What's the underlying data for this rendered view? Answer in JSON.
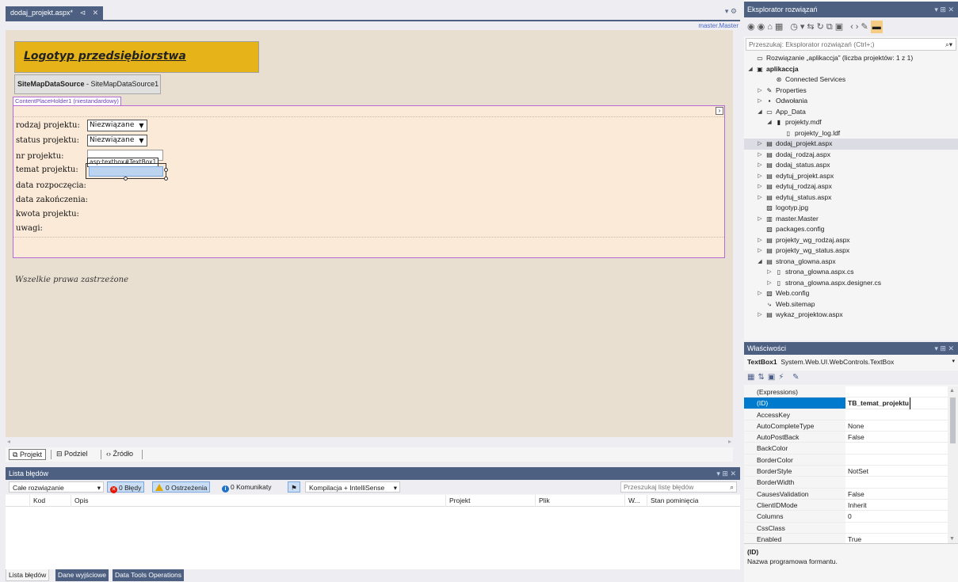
{
  "document": {
    "tab_label": "dodaj_projekt.aspx*",
    "tab_pin_icon": "⊲",
    "tab_close_icon": "✕",
    "master_link": "master.Master",
    "logo_text": "Logotyp przedsiębiorstwa",
    "sitemap_name": "SiteMapDataSource",
    "sitemap_id": " - SiteMapDataSource1",
    "content_placeholder_label": "ContentPlaceHolder1 (niestandardowy)",
    "form_fields": [
      {
        "label": "rodzaj projektu:",
        "control": "dropdown",
        "value": "Niezwiązane"
      },
      {
        "label": "status projektu:",
        "control": "dropdown",
        "value": "Niezwiązane"
      },
      {
        "label": "nr projektu:",
        "control": "textbox",
        "value": ""
      },
      {
        "label": "temat projektu:",
        "control": "textbox-selected",
        "value": ""
      },
      {
        "label": "data rozpoczęcia:",
        "control": "none",
        "value": ""
      },
      {
        "label": "data zakończenia:",
        "control": "none",
        "value": ""
      },
      {
        "label": "kwota projektu:",
        "control": "none",
        "value": ""
      },
      {
        "label": "uwagi:",
        "control": "none",
        "value": ""
      }
    ],
    "selected_control_tag": "asp:textbox#TextBox1",
    "footer_text": "Wszelkie prawa zastrzeżone",
    "view_tabs": [
      "Projekt",
      "Podziel",
      "Źródło"
    ]
  },
  "error_list": {
    "title": "Lista błędów",
    "scope_combo": "Całe rozwiązanie",
    "errors_label": "0 Błędy",
    "warnings_label": "0 Ostrzeżenia",
    "messages_label": "0 Komunikaty",
    "build_combo": "Kompilacja + IntelliSense",
    "search_placeholder": "Przeszukaj listę błędów",
    "columns": [
      "Kod",
      "Opis",
      "Projekt",
      "Plik",
      "W...",
      "Stan pominięcia"
    ],
    "bottom_tabs": [
      "Lista błędów",
      "Dane wyjściowe",
      "Data Tools Operations"
    ]
  },
  "solution_explorer": {
    "title": "Eksplorator rozwiązań",
    "search_placeholder": "Przeszukaj: Eksplorator rozwiązań (Ctrl+;)",
    "tree": [
      {
        "label": "Rozwiązanie „aplikaccja” (liczba projektów: 1 z 1)",
        "depth": 0,
        "expander": "",
        "icon": "solution-icon",
        "bold": false,
        "selected": false
      },
      {
        "label": "aplikaccja",
        "depth": 0,
        "expander": "◢",
        "icon": "web-project-icon",
        "bold": true,
        "selected": false
      },
      {
        "label": "Connected Services",
        "depth": 2,
        "expander": "",
        "icon": "connected-services-icon",
        "bold": false,
        "selected": false
      },
      {
        "label": "Properties",
        "depth": 1,
        "expander": "▷",
        "icon": "wrench-icon",
        "bold": false,
        "selected": false
      },
      {
        "label": "Odwołania",
        "depth": 1,
        "expander": "▷",
        "icon": "references-icon",
        "bold": false,
        "selected": false
      },
      {
        "label": "App_Data",
        "depth": 1,
        "expander": "◢",
        "icon": "folder-icon",
        "bold": false,
        "selected": false
      },
      {
        "label": "projekty.mdf",
        "depth": 2,
        "expander": "◢",
        "icon": "database-icon",
        "bold": false,
        "selected": false
      },
      {
        "label": "projekty_log.ldf",
        "depth": 3,
        "expander": "",
        "icon": "file-icon",
        "bold": false,
        "selected": false
      },
      {
        "label": "dodaj_projekt.aspx",
        "depth": 1,
        "expander": "▷",
        "icon": "aspx-icon",
        "bold": false,
        "selected": true
      },
      {
        "label": "dodaj_rodzaj.aspx",
        "depth": 1,
        "expander": "▷",
        "icon": "aspx-icon",
        "bold": false,
        "selected": false
      },
      {
        "label": "dodaj_status.aspx",
        "depth": 1,
        "expander": "▷",
        "icon": "aspx-icon",
        "bold": false,
        "selected": false
      },
      {
        "label": "edytuj_projekt.aspx",
        "depth": 1,
        "expander": "▷",
        "icon": "aspx-icon",
        "bold": false,
        "selected": false
      },
      {
        "label": "edytuj_rodzaj.aspx",
        "depth": 1,
        "expander": "▷",
        "icon": "aspx-icon",
        "bold": false,
        "selected": false
      },
      {
        "label": "edytuj_status.aspx",
        "depth": 1,
        "expander": "▷",
        "icon": "aspx-icon",
        "bold": false,
        "selected": false
      },
      {
        "label": "logotyp.jpg",
        "depth": 1,
        "expander": "",
        "icon": "image-icon",
        "bold": false,
        "selected": false
      },
      {
        "label": "master.Master",
        "depth": 1,
        "expander": "▷",
        "icon": "master-page-icon",
        "bold": false,
        "selected": false
      },
      {
        "label": "packages.config",
        "depth": 1,
        "expander": "",
        "icon": "config-icon",
        "bold": false,
        "selected": false
      },
      {
        "label": "projekty_wg_rodzaj.aspx",
        "depth": 1,
        "expander": "▷",
        "icon": "aspx-icon",
        "bold": false,
        "selected": false
      },
      {
        "label": "projekty_wg_status.aspx",
        "depth": 1,
        "expander": "▷",
        "icon": "aspx-icon",
        "bold": false,
        "selected": false
      },
      {
        "label": "strona_glowna.aspx",
        "depth": 1,
        "expander": "◢",
        "icon": "aspx-icon",
        "bold": false,
        "selected": false
      },
      {
        "label": "strona_glowna.aspx.cs",
        "depth": 2,
        "expander": "▷",
        "icon": "cs-file-icon",
        "bold": false,
        "selected": false
      },
      {
        "label": "strona_glowna.aspx.designer.cs",
        "depth": 2,
        "expander": "▷",
        "icon": "cs-file-icon",
        "bold": false,
        "selected": false
      },
      {
        "label": "Web.config",
        "depth": 1,
        "expander": "▷",
        "icon": "config-icon",
        "bold": false,
        "selected": false
      },
      {
        "label": "Web.sitemap",
        "depth": 1,
        "expander": "",
        "icon": "sitemap-icon",
        "bold": false,
        "selected": false
      },
      {
        "label": "wykaz_projektow.aspx",
        "depth": 1,
        "expander": "▷",
        "icon": "aspx-icon",
        "bold": false,
        "selected": false
      }
    ]
  },
  "properties": {
    "title": "Właściwości",
    "object_name": "TextBox1",
    "object_type": "System.Web.UI.WebControls.TextBox",
    "rows": [
      {
        "name": "(Expressions)",
        "value": ""
      },
      {
        "name": "(ID)",
        "value": "TB_temat_projektu",
        "selected": true
      },
      {
        "name": "AccessKey",
        "value": ""
      },
      {
        "name": "AutoCompleteType",
        "value": "None"
      },
      {
        "name": "AutoPostBack",
        "value": "False"
      },
      {
        "name": "BackColor",
        "value": ""
      },
      {
        "name": "BorderColor",
        "value": ""
      },
      {
        "name": "BorderStyle",
        "value": "NotSet"
      },
      {
        "name": "BorderWidth",
        "value": ""
      },
      {
        "name": "CausesValidation",
        "value": "False"
      },
      {
        "name": "ClientIDMode",
        "value": "Inherit"
      },
      {
        "name": "Columns",
        "value": "0"
      },
      {
        "name": "CssClass",
        "value": ""
      },
      {
        "name": "Enabled",
        "value": "True"
      }
    ],
    "desc_title": "(ID)",
    "desc_text": "Nazwa programowa formantu."
  },
  "colors": {
    "accent": "#4d6082",
    "selection": "#007acc",
    "logo_bg": "#e6b418",
    "content_bg": "#fbead8",
    "design_bg": "#e8dfd0"
  }
}
